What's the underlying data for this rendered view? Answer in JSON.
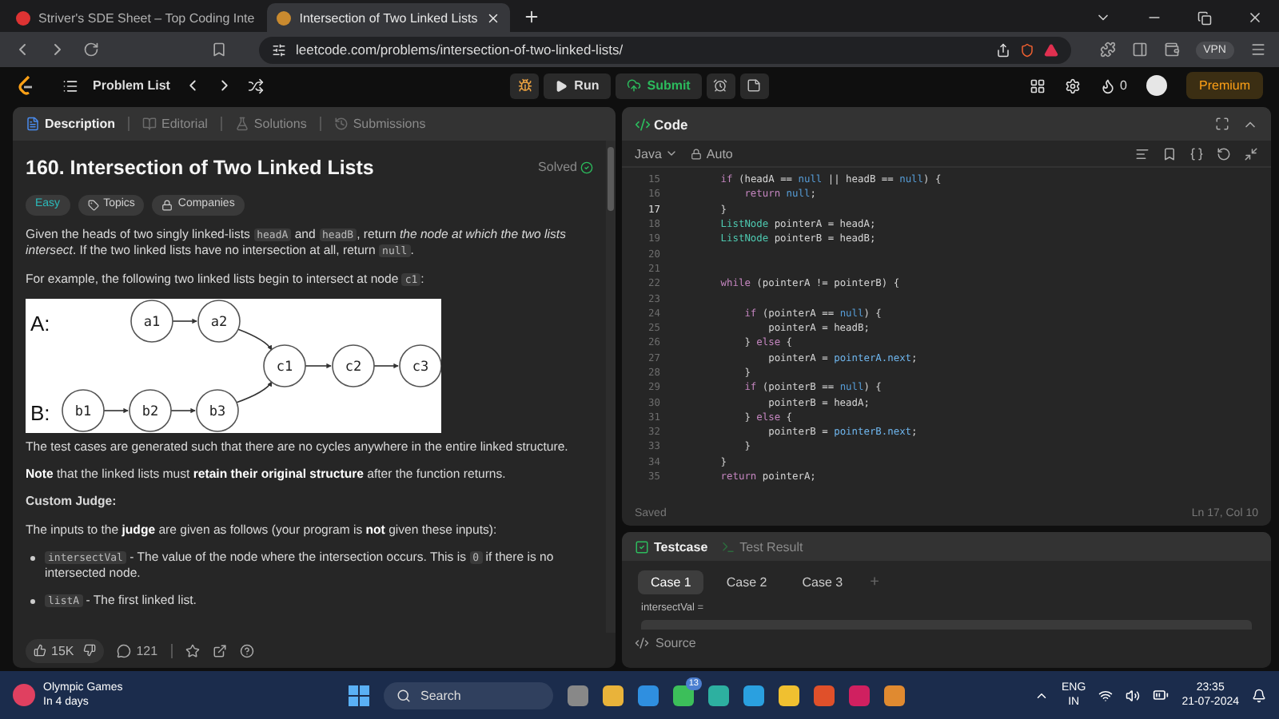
{
  "browser": {
    "tabs": [
      {
        "title": "Striver's SDE Sheet – Top Coding Inte",
        "selected": false
      },
      {
        "title": "Intersection of Two Linked Lists",
        "selected": true
      }
    ],
    "url": "leetcode.com/problems/intersection-of-two-linked-lists/",
    "vpn": "VPN"
  },
  "navbar": {
    "problem_list": "Problem List",
    "run": "Run",
    "submit": "Submit",
    "streak": "0",
    "premium": "Premium"
  },
  "description_panel": {
    "tabs": [
      {
        "label": "Description",
        "selected": true
      },
      {
        "label": "Editorial",
        "selected": false
      },
      {
        "label": "Solutions",
        "selected": false
      },
      {
        "label": "Submissions",
        "selected": false
      }
    ],
    "title": "160. Intersection of Two Linked Lists",
    "status": "Solved",
    "difficulty": "Easy",
    "topics": "Topics",
    "companies": "Companies",
    "blocks": [
      {
        "kind": "paragraph",
        "segments": [
          {
            "text": "Given the heads of two singly linked-lists ",
            "kind": "plain"
          },
          {
            "text": "headA",
            "kind": "code"
          },
          {
            "text": " and ",
            "kind": "plain"
          },
          {
            "text": "headB",
            "kind": "code"
          },
          {
            "text": ", return ",
            "kind": "plain"
          },
          {
            "text": "the node at which the two lists intersect",
            "kind": "italic"
          },
          {
            "text": ". If the two linked lists have no intersection at all, return ",
            "kind": "plain"
          },
          {
            "text": "null",
            "kind": "code"
          },
          {
            "text": ".",
            "kind": "plain"
          }
        ]
      },
      {
        "kind": "paragraph",
        "segments": [
          {
            "text": "For example, the following two linked lists begin to intersect at node ",
            "kind": "plain"
          },
          {
            "text": "c1",
            "kind": "code"
          },
          {
            "text": ":",
            "kind": "plain"
          }
        ]
      },
      {
        "kind": "diagram",
        "label_a": "A:",
        "label_b": "B:",
        "nodes": [
          "a1",
          "a2",
          "c1",
          "c2",
          "c3",
          "b1",
          "b2",
          "b3"
        ]
      },
      {
        "kind": "paragraph",
        "segments": [
          {
            "text": "The test cases are generated such that there are no cycles anywhere in the entire linked structure.",
            "kind": "plain"
          }
        ]
      },
      {
        "kind": "paragraph",
        "segments": [
          {
            "text": "Note",
            "kind": "bold"
          },
          {
            "text": " that the linked lists must ",
            "kind": "plain"
          },
          {
            "text": "retain their original structure",
            "kind": "bold"
          },
          {
            "text": " after the function returns.",
            "kind": "plain"
          }
        ]
      },
      {
        "kind": "heading",
        "text": "Custom Judge:"
      },
      {
        "kind": "paragraph",
        "segments": [
          {
            "text": "The inputs to the ",
            "kind": "plain"
          },
          {
            "text": "judge",
            "kind": "bold"
          },
          {
            "text": " are given as follows (your program is ",
            "kind": "plain"
          },
          {
            "text": "not",
            "kind": "bold"
          },
          {
            "text": " given these inputs):",
            "kind": "plain"
          }
        ]
      },
      {
        "kind": "bullet",
        "segments": [
          {
            "text": "intersectVal",
            "kind": "code"
          },
          {
            "text": " - The value of the node where the intersection occurs. This is ",
            "kind": "plain"
          },
          {
            "text": "0",
            "kind": "code"
          },
          {
            "text": " if there is no intersected node.",
            "kind": "plain"
          }
        ]
      },
      {
        "kind": "bullet",
        "segments": [
          {
            "text": "listA",
            "kind": "code"
          },
          {
            "text": " - The first linked list.",
            "kind": "plain"
          }
        ]
      }
    ],
    "likes": "15K",
    "comments": "121"
  },
  "code_panel": {
    "title": "Code",
    "language": "Java",
    "mode": "Auto",
    "lines": [
      {
        "number": "15",
        "current": false,
        "tokens": [
          {
            "text": "        if",
            "kind": "keyword"
          },
          {
            "text": " (headA == ",
            "kind": "plain"
          },
          {
            "text": "null",
            "kind": "literal"
          },
          {
            "text": " || headB == ",
            "kind": "plain"
          },
          {
            "text": "null",
            "kind": "literal"
          },
          {
            "text": ") {",
            "kind": "plain"
          }
        ]
      },
      {
        "number": "16",
        "current": false,
        "tokens": [
          {
            "text": "            return ",
            "kind": "keyword"
          },
          {
            "text": "null",
            "kind": "literal"
          },
          {
            "text": ";",
            "kind": "plain"
          }
        ]
      },
      {
        "number": "17",
        "current": true,
        "tokens": [
          {
            "text": "        }",
            "kind": "plain"
          }
        ]
      },
      {
        "number": "18",
        "current": false,
        "tokens": [
          {
            "text": "        ListNode",
            "kind": "type"
          },
          {
            "text": " pointerA = headA;",
            "kind": "plain"
          }
        ]
      },
      {
        "number": "19",
        "current": false,
        "tokens": [
          {
            "text": "        ListNode",
            "kind": "type"
          },
          {
            "text": " pointerB = headB;",
            "kind": "plain"
          }
        ]
      },
      {
        "number": "20",
        "current": false
      },
      {
        "number": "21",
        "current": false
      },
      {
        "number": "22",
        "current": false,
        "tokens": [
          {
            "text": "        while",
            "kind": "keyword"
          },
          {
            "text": " (pointerA != pointerB) {",
            "kind": "plain"
          }
        ]
      },
      {
        "number": "23",
        "current": false
      },
      {
        "number": "24",
        "current": false,
        "tokens": [
          {
            "text": "            if",
            "kind": "keyword"
          },
          {
            "text": " (pointerA == ",
            "kind": "plain"
          },
          {
            "text": "null",
            "kind": "literal"
          },
          {
            "text": ") {",
            "kind": "plain"
          }
        ]
      },
      {
        "number": "25",
        "current": false,
        "tokens": [
          {
            "text": "                pointerA = headB;",
            "kind": "plain"
          }
        ]
      },
      {
        "number": "26",
        "current": false,
        "tokens": [
          {
            "text": "            } ",
            "kind": "plain"
          },
          {
            "text": "else",
            "kind": "keyword"
          },
          {
            "text": " {",
            "kind": "plain"
          }
        ]
      },
      {
        "number": "27",
        "current": false,
        "tokens": [
          {
            "text": "                pointerA = ",
            "kind": "plain"
          },
          {
            "text": "pointerA.next",
            "kind": "member"
          },
          {
            "text": ";",
            "kind": "plain"
          }
        ]
      },
      {
        "number": "28",
        "current": false,
        "tokens": [
          {
            "text": "            }",
            "kind": "plain"
          }
        ]
      },
      {
        "number": "29",
        "current": false,
        "tokens": [
          {
            "text": "            if",
            "kind": "keyword"
          },
          {
            "text": " (pointerB == ",
            "kind": "plain"
          },
          {
            "text": "null",
            "kind": "literal"
          },
          {
            "text": ") {",
            "kind": "plain"
          }
        ]
      },
      {
        "number": "30",
        "current": false,
        "tokens": [
          {
            "text": "                pointerB = headA;",
            "kind": "plain"
          }
        ]
      },
      {
        "number": "31",
        "current": false,
        "tokens": [
          {
            "text": "            } ",
            "kind": "plain"
          },
          {
            "text": "else",
            "kind": "keyword"
          },
          {
            "text": " {",
            "kind": "plain"
          }
        ]
      },
      {
        "number": "32",
        "current": false,
        "tokens": [
          {
            "text": "                pointerB = ",
            "kind": "plain"
          },
          {
            "text": "pointerB.next",
            "kind": "member"
          },
          {
            "text": ";",
            "kind": "plain"
          }
        ]
      },
      {
        "number": "33",
        "current": false,
        "tokens": [
          {
            "text": "            }",
            "kind": "plain"
          }
        ]
      },
      {
        "number": "34",
        "current": false,
        "tokens": [
          {
            "text": "        }",
            "kind": "plain"
          }
        ]
      },
      {
        "number": "35",
        "current": false,
        "tokens": [
          {
            "text": "        return",
            "kind": "keyword"
          },
          {
            "text": " pointerA;",
            "kind": "plain"
          }
        ]
      }
    ],
    "saved": "Saved",
    "cursor": "Ln 17, Col 10"
  },
  "test_panel": {
    "tabs": [
      {
        "label": "Testcase",
        "selected": true
      },
      {
        "label": "Test Result",
        "selected": false
      }
    ],
    "cases": [
      {
        "label": "Case 1",
        "selected": true
      },
      {
        "label": "Case 2",
        "selected": false
      },
      {
        "label": "Case 3",
        "selected": false
      }
    ],
    "add": "+",
    "field_label": "intersectVal =",
    "source": "Source"
  },
  "taskbar": {
    "widget_title": "Olympic Games",
    "widget_subtitle": "In 4 days",
    "search": "Search",
    "chat_badge": "13",
    "language": "ENG",
    "region": "IN",
    "time": "23:35",
    "date": "21-07-2024"
  }
}
